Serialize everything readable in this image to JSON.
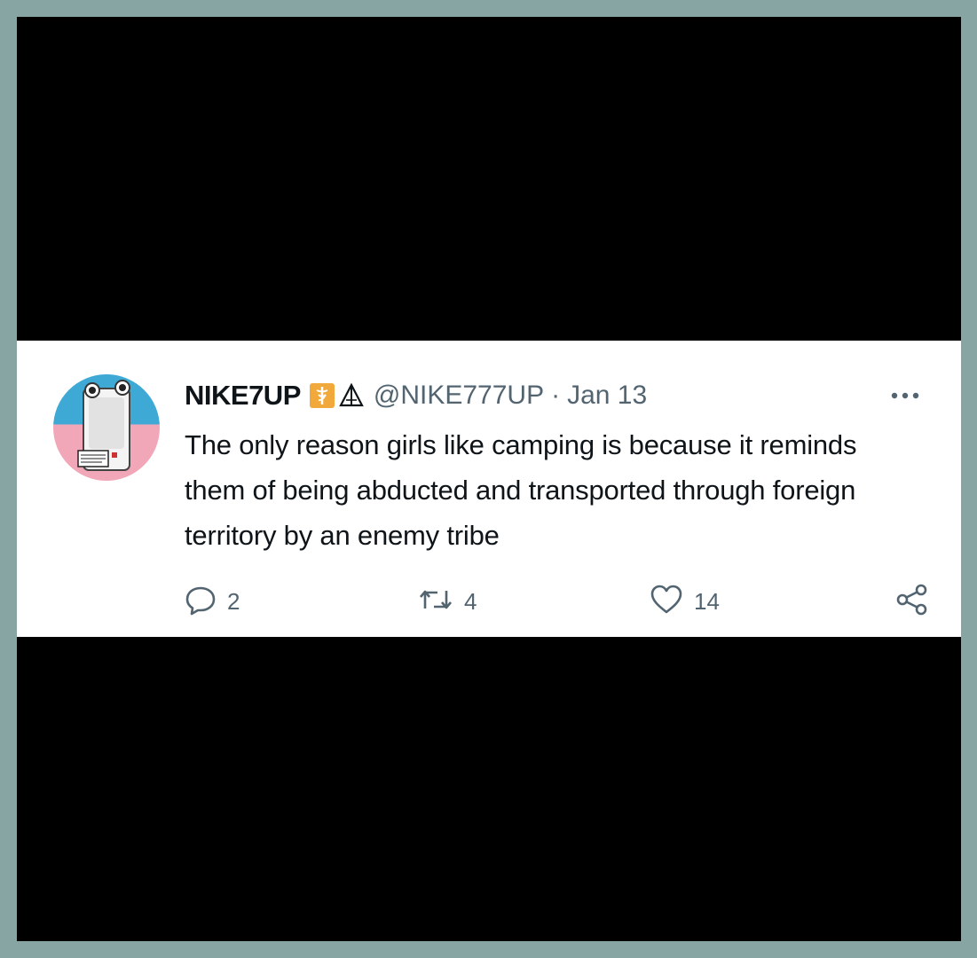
{
  "tweet": {
    "display_name": "NIKE7UP",
    "handle": "@NIKE777UP",
    "separator": "·",
    "date": "Jan 13",
    "text": "The only reason girls like camping is because it reminds them of being abducted and transported through foreign territory by an enemy tribe",
    "reply_count": "2",
    "retweet_count": "4",
    "like_count": "14"
  },
  "icons": {
    "more": "more-options-icon",
    "reply": "reply-icon",
    "retweet": "retweet-icon",
    "like": "heart-icon",
    "share": "share-icon",
    "badge1": "medical-symbol-badge-icon",
    "badge2": "sailboat-icon"
  },
  "colors": {
    "page_border": "#86a5a3",
    "letterbox": "#000000",
    "card": "#ffffff",
    "text_primary": "#0f1419",
    "text_secondary": "#536471",
    "badge_orange": "#f2a93b"
  }
}
